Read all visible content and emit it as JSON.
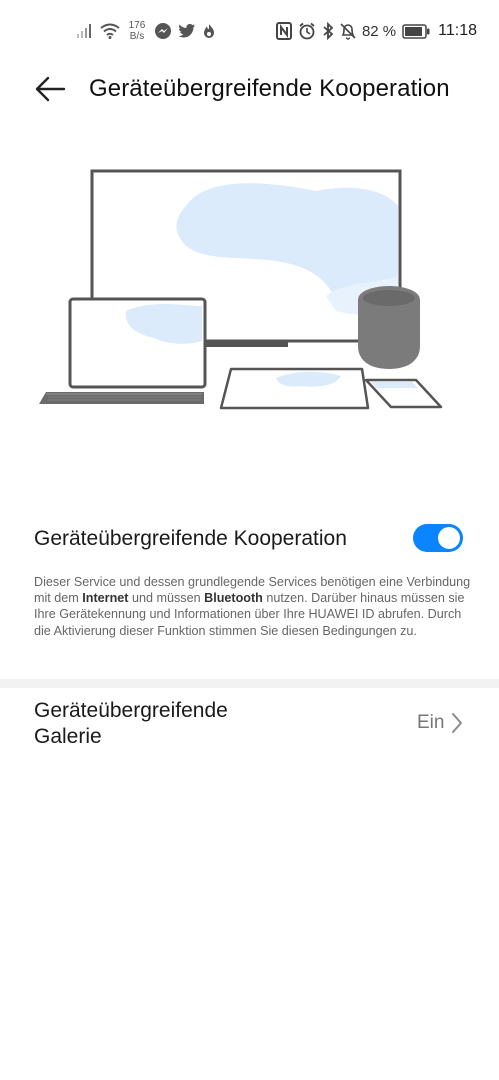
{
  "status_bar": {
    "net_speed_value": "176",
    "net_speed_unit": "B/s",
    "battery": "82 %",
    "time": "11:18",
    "icons": [
      "signal-icon",
      "wifi-icon",
      "messenger-icon",
      "twitter-icon",
      "flame-icon",
      "nfc-icon",
      "alarm-icon",
      "bluetooth-icon",
      "bell-off-icon",
      "battery-icon"
    ]
  },
  "header": {
    "title": "Geräteübergreifende Kooperation",
    "back_icon": "arrow-left-icon"
  },
  "illustration": {
    "devices": [
      "monitor",
      "laptop",
      "tablet",
      "phone",
      "smart-speaker"
    ],
    "accent": "#dcebfb",
    "speaker_color": "#7b7b7b"
  },
  "cooperation": {
    "label": "Geräteübergreifende Kooperation",
    "enabled": true,
    "accent": "#0a84ff",
    "desc_part1": "Dieser Service und dessen grundlegende Services benötigen eine Verbindung mit dem ",
    "desc_bold1": "Internet",
    "desc_part2": " und müssen ",
    "desc_bold2": "Bluetooth",
    "desc_part3": " nutzen. Darüber hinaus müssen sie Ihre Gerätekennung und Informationen über Ihre HUAWEI ID abrufen. Durch die Aktivierung dieser Funktion stimmen Sie diesen Bedingungen zu."
  },
  "gallery": {
    "label": "Geräteübergreifende\nGalerie",
    "value": "Ein",
    "chevron_icon": "chevron-right-icon"
  }
}
